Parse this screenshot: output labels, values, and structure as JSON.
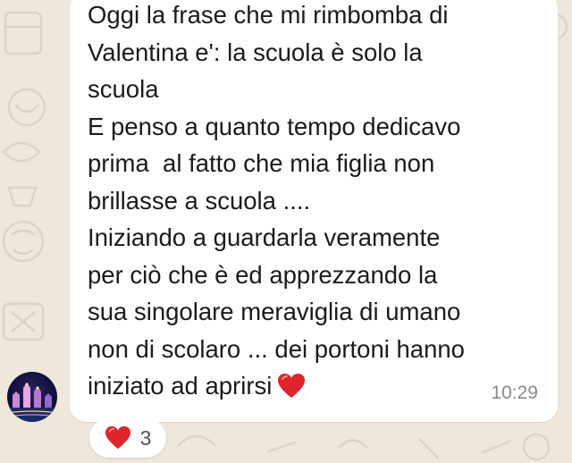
{
  "message": {
    "lines": [
      "Oggi la frase che mi rimbomba di",
      "Valentina e': la scuola è solo la",
      "scuola",
      "E penso a quanto tempo dedicavo",
      "prima  al fatto che mia figlia non",
      "brillasse a scuola ....",
      "Iniziando a guardarla veramente",
      "per ciò che è ed apprezzando la",
      "sua singolare meraviglia di umano",
      "non di scolaro ... dei portoni hanno",
      "iniziato ad aprirsi"
    ],
    "trailing_emoji": "red-heart",
    "time": "10:29"
  },
  "reaction": {
    "emoji": "red-heart",
    "count": "3"
  },
  "colors": {
    "chat_background": "#efe7dc",
    "bubble": "#ffffff",
    "heart": "#e0242c",
    "timestamp": "#8a8a8a"
  }
}
